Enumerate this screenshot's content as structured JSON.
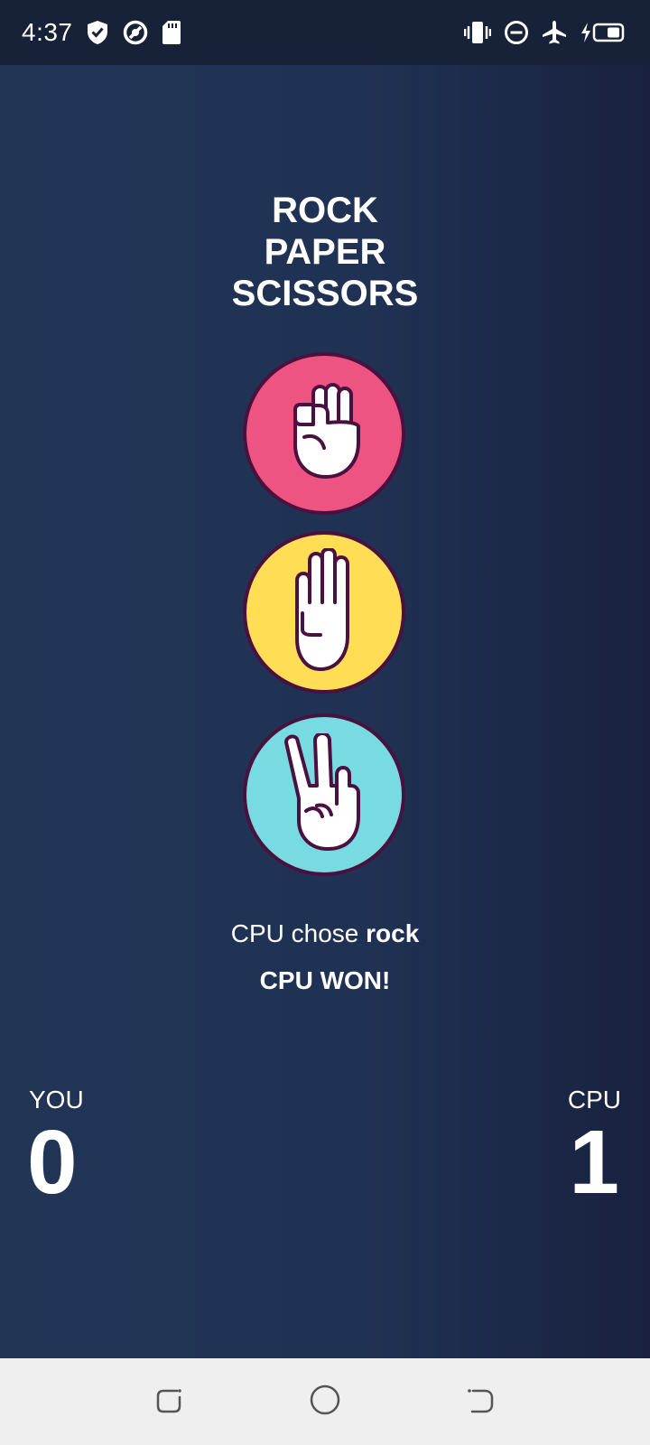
{
  "status_bar": {
    "time": "4:37",
    "left_icons": [
      "shield-check-icon",
      "data-saver-icon",
      "sd-card-icon"
    ],
    "right_icons": [
      "vibrate-icon",
      "do-not-disturb-icon",
      "airplane-icon",
      "battery-charging-icon"
    ]
  },
  "game": {
    "title_lines": [
      "ROCK",
      "PAPER",
      "SCISSORS"
    ],
    "choices": [
      {
        "name": "rock",
        "icon": "rock-fist-icon",
        "color": "#ee5482"
      },
      {
        "name": "paper",
        "icon": "paper-hand-icon",
        "color": "#ffdd55"
      },
      {
        "name": "scissors",
        "icon": "scissors-hand-icon",
        "color": "#79dbe2"
      }
    ],
    "result_prefix": "CPU chose ",
    "cpu_choice": "rock",
    "winner_text": "CPU WON!"
  },
  "scoreboard": {
    "you_label": "YOU",
    "you_score": "0",
    "cpu_label": "CPU",
    "cpu_score": "1"
  },
  "nav_bar": {
    "buttons": [
      "recents-icon",
      "home-icon",
      "back-icon"
    ]
  },
  "colors": {
    "background": "#1f3050",
    "rock": "#ee5482",
    "paper": "#ffdd55",
    "scissors": "#79dbe2",
    "icon_outline": "#4a1040"
  }
}
